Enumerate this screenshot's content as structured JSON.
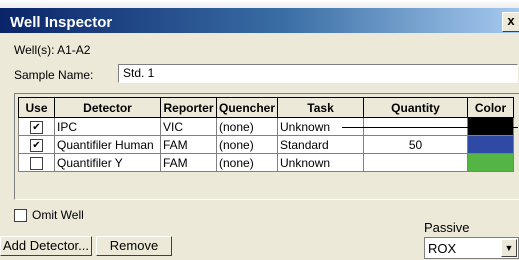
{
  "window": {
    "title": "Well Inspector",
    "close_glyph": "x"
  },
  "wells": "Well(s): A1-A2",
  "sample_name": {
    "label": "Sample Name:",
    "value": "Std. 1"
  },
  "table": {
    "headers": [
      "Use",
      "Detector",
      "Reporter",
      "Quencher",
      "Task",
      "Quantity",
      "Color"
    ],
    "rows": [
      {
        "use": true,
        "detector": "IPC",
        "reporter": "VIC",
        "quencher": "(none)",
        "task": "Unknown",
        "quantity": "",
        "color": "#000000"
      },
      {
        "use": true,
        "detector": "Quantifiler Human",
        "reporter": "FAM",
        "quencher": "(none)",
        "task": "Standard",
        "quantity": "50",
        "color": "#2e4aa5"
      },
      {
        "use": false,
        "detector": "Quantifiler Y",
        "reporter": "FAM",
        "quencher": "(none)",
        "task": "Unknown",
        "quantity": "",
        "color": "#55b544"
      }
    ]
  },
  "omit_well": {
    "label": "Omit Well",
    "checked": false
  },
  "buttons": {
    "add_detector": "Add Detector...",
    "remove": "Remove"
  },
  "passive": {
    "label": "Passive",
    "value": "ROX"
  }
}
